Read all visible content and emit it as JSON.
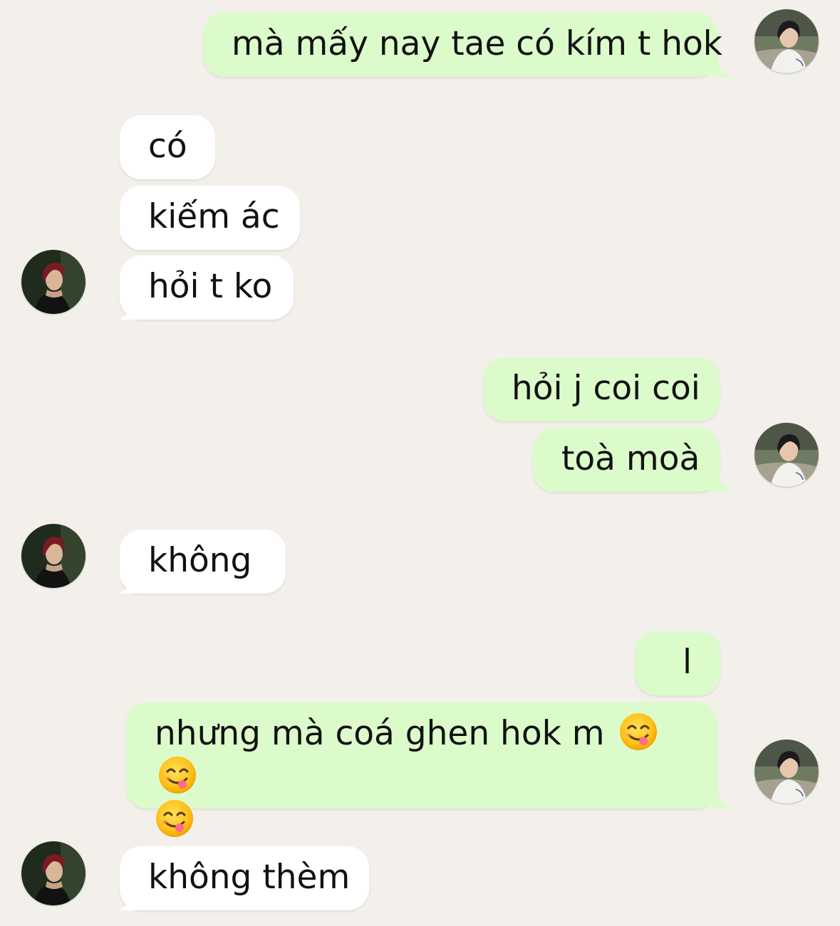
{
  "conversation": {
    "messages": [
      {
        "id": "m1",
        "sender": "me",
        "text": "mà mấy nay tae có kím t hok"
      },
      {
        "id": "m2",
        "sender": "them",
        "text": "có"
      },
      {
        "id": "m3",
        "sender": "them",
        "text": "kiếm ác"
      },
      {
        "id": "m4",
        "sender": "them",
        "text": "hỏi t ko"
      },
      {
        "id": "m5",
        "sender": "me",
        "text": "hỏi j coi coi"
      },
      {
        "id": "m6",
        "sender": "me",
        "text": "toà moà"
      },
      {
        "id": "m7",
        "sender": "them",
        "text": "không"
      },
      {
        "id": "m8",
        "sender": "me",
        "text": "l"
      },
      {
        "id": "m9",
        "sender": "me",
        "text": "nhưng mà coá ghen hok m",
        "emojis": [
          "face-savoring-food-emoji",
          "face-savoring-food-emoji",
          "face-savoring-food-emoji"
        ]
      },
      {
        "id": "m10",
        "sender": "them",
        "text": "không thèm"
      }
    ]
  },
  "colors": {
    "background": "#f3f0eb",
    "me_bubble": "#dcfbcb",
    "them_bubble": "#ffffff",
    "text": "#111111"
  },
  "icons": {
    "me_avatar": "avatar-photo-dark-hair-white-shirt",
    "them_avatar": "avatar-photo-red-hair-dark-shirt",
    "emoji": "face-savoring-food-emoji"
  }
}
